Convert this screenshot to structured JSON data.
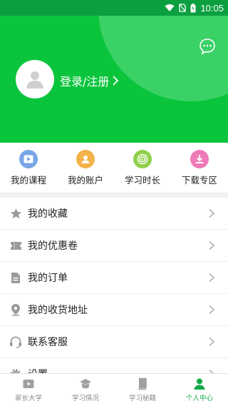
{
  "status_bar": {
    "time": "10:05",
    "bg": "#0c9f40"
  },
  "header": {
    "login_text": "登录/注册",
    "bg": "#0ac43c",
    "message_icon": "chat-bubble-icon"
  },
  "quick_actions": [
    {
      "label": "我的课程",
      "icon": "course-icon",
      "color": "#7aa6e8"
    },
    {
      "label": "我的账户",
      "icon": "account-icon",
      "color": "#f3b24a"
    },
    {
      "label": "学习时长",
      "icon": "study-time-icon",
      "color": "#8fd14a"
    },
    {
      "label": "下载专区",
      "icon": "download-icon",
      "color": "#f07ab8"
    }
  ],
  "menu": [
    {
      "label": "我的收藏",
      "icon": "star-icon"
    },
    {
      "label": "我的优惠卷",
      "icon": "coupon-icon"
    },
    {
      "label": "我的订单",
      "icon": "order-icon"
    },
    {
      "label": "我的收货地址",
      "icon": "location-icon"
    },
    {
      "label": "联系客服",
      "icon": "headset-icon"
    },
    {
      "label": "设置",
      "icon": "settings-icon"
    }
  ],
  "tabbar": [
    {
      "label": "家长大学",
      "icon": "video-icon",
      "active": false
    },
    {
      "label": "学习情况",
      "icon": "graduation-cap-icon",
      "active": false
    },
    {
      "label": "学习秘籍",
      "icon": "book-icon",
      "active": false
    },
    {
      "label": "个人中心",
      "icon": "person-icon",
      "active": true
    }
  ],
  "colors": {
    "accent": "#13a848",
    "muted_icon": "#9a9a9a"
  }
}
